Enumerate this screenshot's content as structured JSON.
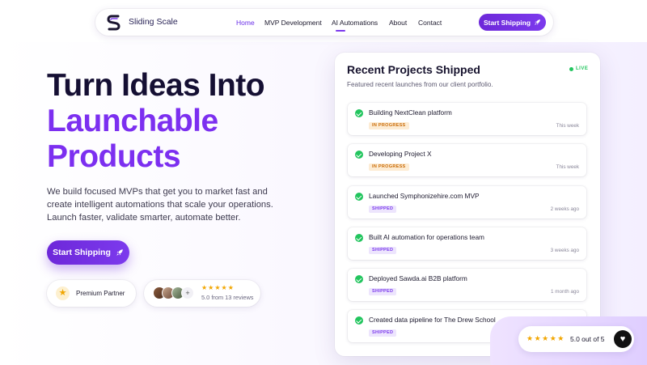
{
  "nav": {
    "brand": "Sliding Scale",
    "links": [
      {
        "label": "Home",
        "active": true
      },
      {
        "label": "MVP Development"
      },
      {
        "label": "AI Automations"
      },
      {
        "label": "About"
      },
      {
        "label": "Contact"
      }
    ],
    "cta_label": "Start Shipping",
    "cta_icon": "rocket-icon"
  },
  "hero": {
    "line1": "Turn Ideas Into",
    "line2": "Launchable",
    "line3": "Products",
    "description": "We build focused MVPs that get you to market fast and create intelligent automations that scale your operations. Launch faster, validate smarter, automate better.",
    "cta_label": "Start Shipping",
    "cta_icon": "rocket-icon"
  },
  "partner": {
    "label": "Premium Partner",
    "icon": "star-icon"
  },
  "reviews": {
    "stars": "★★★★★",
    "plus": "+",
    "summary": "5.0 from 13 reviews"
  },
  "projects": {
    "title": "Recent Projects Shipped",
    "subtitle": "Featured recent launches from our client portfolio.",
    "live_label": "LIVE",
    "items": [
      {
        "title": "Building NextClean platform",
        "status": "IN PROGRESS",
        "time": "This week"
      },
      {
        "title": "Developing Project X",
        "status": "IN PROGRESS",
        "time": "This week"
      },
      {
        "title": "Launched Symphonizehire.com MVP",
        "status": "SHIPPED",
        "time": "2 weeks ago"
      },
      {
        "title": "Built AI automation for operations team",
        "status": "SHIPPED",
        "time": "3 weeks ago"
      },
      {
        "title": "Deployed Sawda.ai B2B platform",
        "status": "SHIPPED",
        "time": "1 month ago"
      },
      {
        "title": "Created data pipeline for The Drew School",
        "status": "SHIPPED",
        "time": ""
      }
    ]
  },
  "rating": {
    "stars": "★★★★★",
    "text": "5.0 out of 5",
    "icon": "heart-icon"
  },
  "colors": {
    "accent": "#7c3aed",
    "heading": "#150f33",
    "live": "#22c55e",
    "progress": "#c96a05"
  }
}
